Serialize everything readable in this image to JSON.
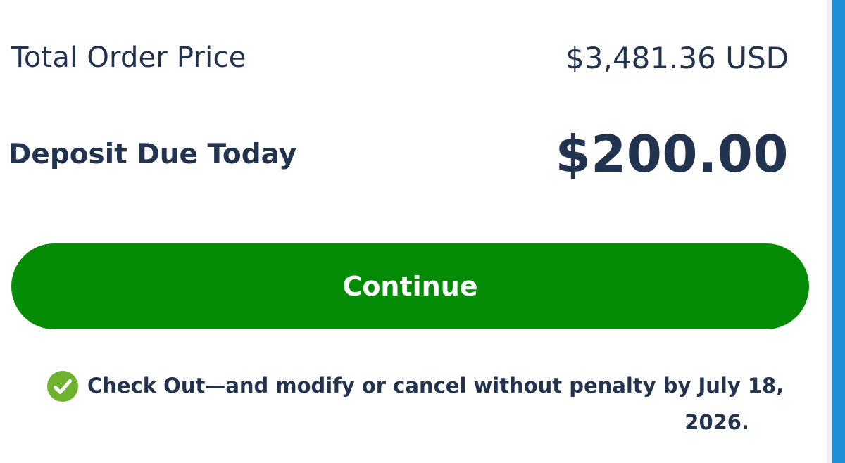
{
  "summary": {
    "total_label": "Total Order Price",
    "total_value": "$3,481.36 USD",
    "deposit_label": "Deposit Due Today",
    "deposit_value": "$200.00"
  },
  "actions": {
    "continue_label": "Continue"
  },
  "note": {
    "icon": "check-circle-icon",
    "line1": "Check Out—and modify or cancel without penalty by July 18,",
    "line2": "2026."
  },
  "colors": {
    "text": "#22334f",
    "button": "#058c06",
    "check": "#6fb22f",
    "edge": "#1e8fd8"
  }
}
